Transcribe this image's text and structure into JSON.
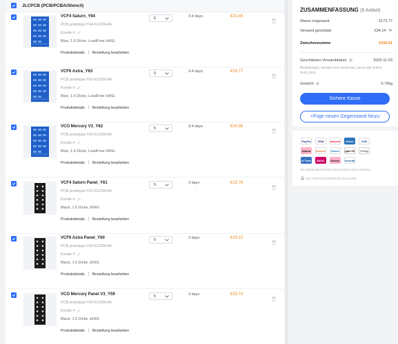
{
  "cart": {
    "group_title": "JLCPCB (PCB/PCBA/Stencil)",
    "items": [
      {
        "name": "VCF4 Saturn_Y64",
        "prototype": "PCB prototype:Y64-6123914A",
        "kunde": "Kunde #:",
        "spec": "Blue, 1.6 Dicke, LeadFree HASL",
        "qty": "5",
        "days": "3-4 days",
        "price": "€31.49",
        "board": "blue",
        "details": "Produktdetails",
        "edit": "Bestellung bearbeiten"
      },
      {
        "name": "VCF6 Astra_Y63",
        "prototype": "PCB prototype:Y63-6123914A",
        "kunde": "Kunde #:",
        "spec": "Blue, 1.6 Dicke, LeadFree HASL",
        "qty": "5",
        "days": "3-4 days",
        "price": "€33.77",
        "board": "blue",
        "details": "Produktdetails",
        "edit": "Bestellung bearbeiten"
      },
      {
        "name": "VCO Mercury V3_Y62",
        "prototype": "PCB prototype:Y62-6123914A",
        "kunde": "Kunde #:",
        "spec": "Blue, 1.6 Dicke, LeadFree HASL",
        "qty": "5",
        "days": "3-4 days",
        "price": "€34.86",
        "board": "blue",
        "details": "Produktdetails",
        "edit": "Bestellung bearbeiten"
      },
      {
        "name": "VCF4 Saturn Panel_Y61",
        "prototype": "PCB prototype:Y61-6123914A",
        "kunde": "Kunde #:",
        "spec": "Black, 1.6 Dicke, ENIG",
        "qty": "5",
        "days": "3 days",
        "price": "€19.76",
        "board": "black",
        "details": "Produktdetails",
        "edit": "Bestellung bearbeiten"
      },
      {
        "name": "VCF6 Astra Panel_Y60",
        "prototype": "PCB prototype:Y60-6123914A",
        "kunde": "Kunde #:",
        "spec": "Black, 1.6 Dicke, ENIG",
        "qty": "5",
        "days": "3 days",
        "price": "€19.15",
        "board": "black",
        "details": "Produktdetails",
        "edit": "Bestellung bearbeiten"
      },
      {
        "name": "VCO Mercury Panel V3_Y59",
        "prototype": "PCB prototype:Y59-6123914A",
        "kunde": "Kunde #:",
        "spec": "Black, 1.6 Dicke, ENIG",
        "qty": "5",
        "days": "3 days",
        "price": "€33.74",
        "board": "black",
        "details": "Produktdetails",
        "edit": "Bestellung bearbeiten"
      }
    ]
  },
  "summary": {
    "title": "ZUSAMMENFASSUNG",
    "count": "(6 Artikel)",
    "goods_label": "Waren insgesamt",
    "goods_value": "€172.77",
    "shipping_label": "Versand geschätzt",
    "shipping_value": "€34.14",
    "subtotal_label": "Zwischensumme",
    "subtotal_value": "€206.91",
    "ship_date_label": "Geschätztes Versanddatum",
    "ship_date_value": "2025-11-03",
    "ship_note": "Bestellungen werden erst versendet, wenn alle Artikel fertig sind.",
    "weight_label": "Gewicht",
    "weight_value": "0.76kg",
    "checkout_button": "Sichere Kasse",
    "add_button": "+Füge neuen Gegenstand hinzu"
  },
  "payments": {
    "methods": [
      "PayPal",
      "VISA",
      "Mastercard",
      "Amex",
      "JCB",
      "Klarna",
      "Discover",
      "Diners",
      "Apple Pay",
      "G Pay",
      "Bank Transfer",
      "iDEAL",
      "Klarna.",
      "Bancontact"
    ],
    "note": "Die Zahlungsmethode kann je nach Land variieren.",
    "ssl": "SSL-VERSCHLÜSSELTE ZAHLUNG"
  },
  "colors": {
    "accent": "#2f6df6",
    "price": "#f08a24",
    "pcb_blue": "#1f5fc6",
    "pcb_black": "#1c1c1c"
  }
}
